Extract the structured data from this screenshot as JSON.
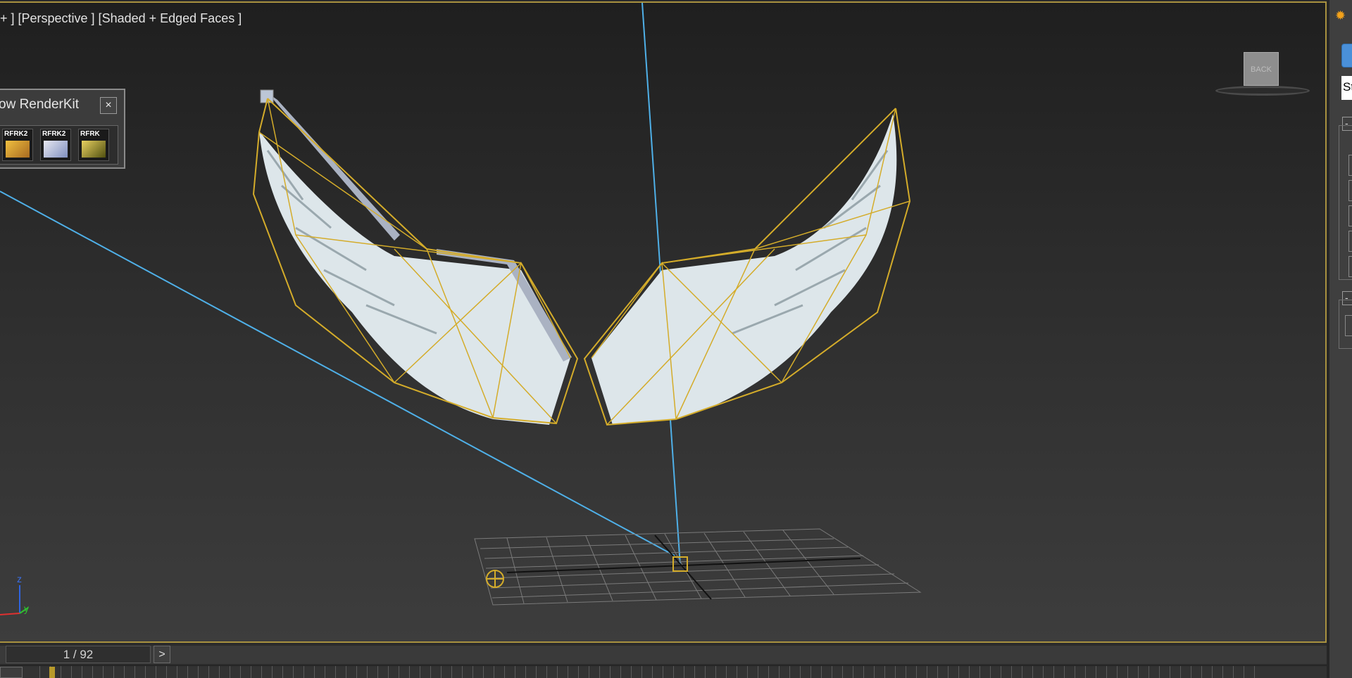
{
  "viewport": {
    "label": "+ ] [Perspective ] [Shaded + Edged Faces ]",
    "viewcube_face": "BACK",
    "axis_labels": {
      "z": "z",
      "y": "y"
    }
  },
  "renderkit": {
    "title": "ow RenderKit",
    "close": "×",
    "icons": [
      {
        "label": "RFRK2",
        "name": "renderkit-icon-1"
      },
      {
        "label": "RFRK2",
        "name": "renderkit-icon-2"
      },
      {
        "label": "RFRK",
        "name": "renderkit-icon-3"
      }
    ]
  },
  "timeline": {
    "frame_display": "1 / 92",
    "next_label": ">"
  },
  "command_panel": {
    "dropdown_value": "St",
    "rollout_minus": "-"
  },
  "colors": {
    "selection_wire": "#d4ac2a",
    "light_target_line": "#4fb0e8",
    "viewport_border": "#a8913f"
  }
}
